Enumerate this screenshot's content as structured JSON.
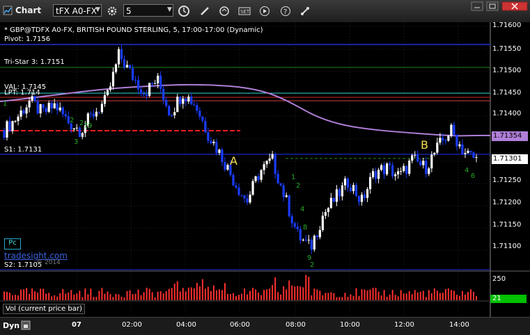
{
  "window": {
    "title": "Chart",
    "symbol_field": "tFX A0-FX",
    "interval_field": "5"
  },
  "chart_header": {
    "instrument": "* GBP@TDFX A0-FX, BRITISH POUND STERLING, 5, 17:00-17:00 (Dynamic)"
  },
  "levels": {
    "pivot": "Pivot: 1.7156",
    "tristar": "Tri-Star 3: 1.7151",
    "val": "VAL: 1.7145",
    "lpt": "LPT: 1.714",
    "s1": "S1: 1.7131",
    "s2": "S2: 1.7105"
  },
  "annotations": {
    "a": "A",
    "b": "B",
    "pc": "Pc",
    "watermark": "tradesight.com",
    "copyright": "© 2014"
  },
  "y_axis": [
    "1.71600",
    "1.71550",
    "1.71500",
    "1.71450",
    "1.71400",
    "1.71354",
    "1.71301",
    "1.71250",
    "1.71200",
    "1.71150",
    "1.71100"
  ],
  "volume_axis": [
    "250",
    "21"
  ],
  "volume_label": "Vol (current price bar)",
  "x_axis": [
    "07",
    "02:00",
    "04:00",
    "06:00",
    "08:00",
    "10:00",
    "12:00",
    "14:00"
  ],
  "bottom": {
    "dyn": "Dyn"
  },
  "colors": {
    "up": "#ffffff",
    "down": "#1a3cff",
    "pivot": "#0000cc",
    "avg": "#b07fd8",
    "support": "#ff2020",
    "volume": "#ff3030",
    "vol_current": "#00c000"
  },
  "counts": [
    "1",
    "2",
    "3",
    "2",
    "7",
    "9",
    "1",
    "2",
    "4",
    "8",
    "9",
    "2",
    "4",
    "6"
  ],
  "chart_data": {
    "type": "candlestick",
    "x": [
      "17:00",
      "02:00",
      "04:00",
      "06:00",
      "08:00",
      "10:00",
      "12:00",
      "14:00"
    ],
    "close_path": [
      1.7137,
      1.714,
      1.7144,
      1.7141,
      1.7143,
      1.7139,
      1.7137,
      1.7141,
      1.7144,
      1.7155,
      1.715,
      1.7146,
      1.7149,
      1.7141,
      1.7146,
      1.7143,
      1.7136,
      1.7131,
      1.7125,
      1.712,
      1.7127,
      1.713,
      1.7121,
      1.7112,
      1.7109,
      1.7117,
      1.7121,
      1.7125,
      1.712,
      1.7127,
      1.7128,
      1.7126,
      1.713,
      1.7128,
      1.7133,
      1.7137,
      1.7132,
      1.713
    ],
    "moving_average_last": 1.71354,
    "last_price": 1.71301,
    "ylim": [
      1.7107,
      1.7162
    ]
  }
}
